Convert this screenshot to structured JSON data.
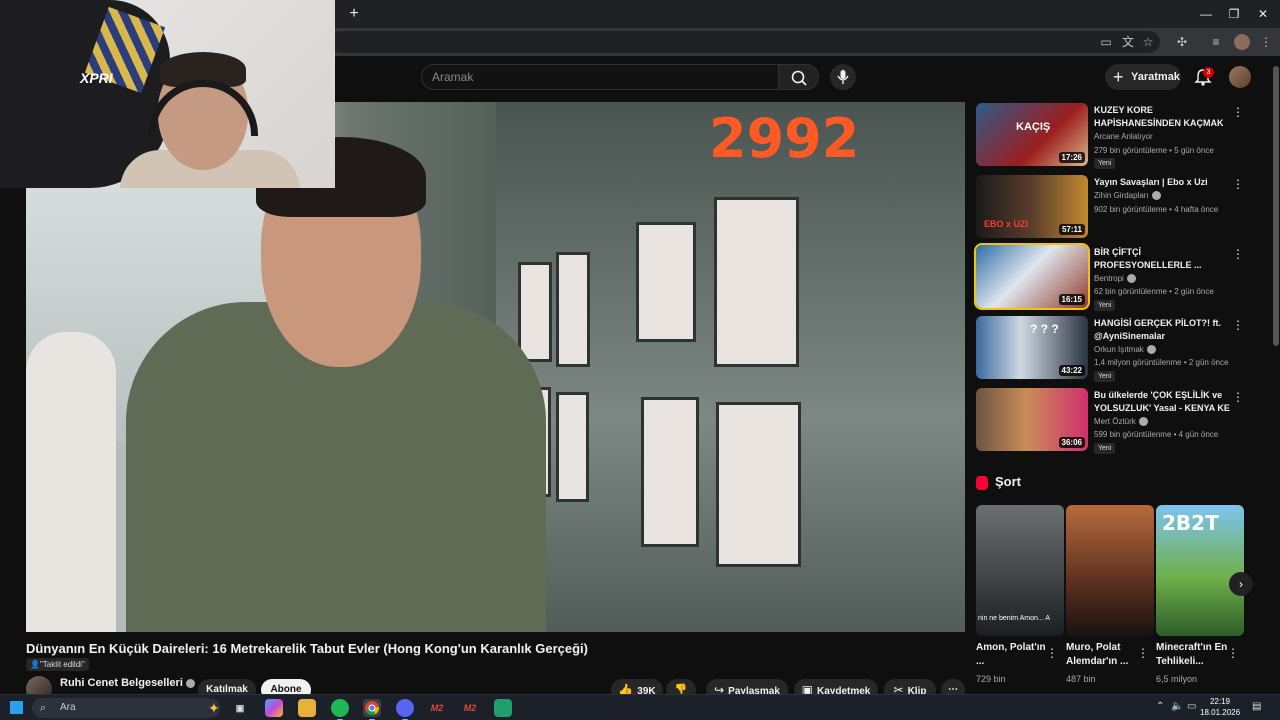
{
  "browser": {
    "new_tab_symbol": "+",
    "window_controls": [
      "—",
      "❐",
      "✕"
    ]
  },
  "youtube": {
    "search_placeholder": "Aramak",
    "create_label": "Yaratmak",
    "notification_count": "3",
    "video": {
      "sign_text": "2992",
      "title": "Dünyanın En Küçük Daireleri: 16 Metrekarelik Tabut Evler (Hong Kong'un Karanlık Gerçeği)",
      "disclaimer": "\"Taklit edildi\"",
      "channel": "Ruhi Cenet Belgeselleri",
      "join_label": "Katılmak",
      "subscribe_label": "Abone",
      "like_count": "39K",
      "share_label": "Paylaşmak",
      "save_label": "Kaydetmek",
      "clip_label": "Klip"
    },
    "recommendations": [
      {
        "title": "KUZEY KORE HAPİSHANESİNDEN KAÇMAK",
        "channel": "Arcane Anlatıyor",
        "meta": "279 bin görüntüleme • 5 gün önce",
        "badge": "Yeni",
        "duration": "17:26",
        "thumb_text": "KAÇIŞ"
      },
      {
        "title": "Yayın Savaşları | Ebo x Uzi",
        "channel": "Zihin Girdapları",
        "meta": "902 bin görüntüleme • 4 hafta önce",
        "badge": "",
        "duration": "57:11",
        "thumb_text": "EBO x UZI"
      },
      {
        "title": "BİR ÇİFTÇİ PROFESYONELLERLE ...",
        "channel": "Bentropi",
        "meta": "62 bin görüntülenme • 2 gün önce",
        "badge": "Yeni",
        "duration": "16:15",
        "thumb_text": ""
      },
      {
        "title": "HANGİSİ GERÇEK PİLOT?! ft. @AyniSinemalar",
        "channel": "Orkun Işıtmak",
        "meta": "1,4 milyon görüntülenme • 2 gün önce",
        "badge": "Yeni",
        "duration": "43:22",
        "thumb_text": "? ? ?"
      },
      {
        "title": "Bu ülkelerde 'ÇOK EŞLİLİK ve YOLSUZLUK' Yasal - KENYA KE",
        "channel": "Mert Öztürk",
        "meta": "599 bin görüntülenme • 4 gün önce",
        "badge": "Yeni",
        "duration": "36:06",
        "thumb_text": ""
      }
    ],
    "shorts_heading": "Şort",
    "shorts": [
      {
        "title": "Amon, Polat'ın ...",
        "views": "729 bin",
        "caption": "nin ne benim Amon... A",
        "thumb_text": ""
      },
      {
        "title": "Muro, Polat Alemdar'ın ...",
        "views": "487 bin",
        "caption": "",
        "thumb_text": ""
      },
      {
        "title": "Minecraft'ın En Tehlikeli...",
        "views": "6,5 milyon",
        "caption": "",
        "thumb_text": "2B2T"
      }
    ]
  },
  "webcam": {
    "chair_logo": "XPRI"
  },
  "taskbar": {
    "search_label": "Ara",
    "time": "22:19",
    "date": "18.01.2026"
  },
  "colors": {
    "youtube_bg": "#0f0f0f",
    "accent_red": "#ff0033",
    "active_outline": "#f3c400",
    "sign_orange": "#ff5a26"
  }
}
